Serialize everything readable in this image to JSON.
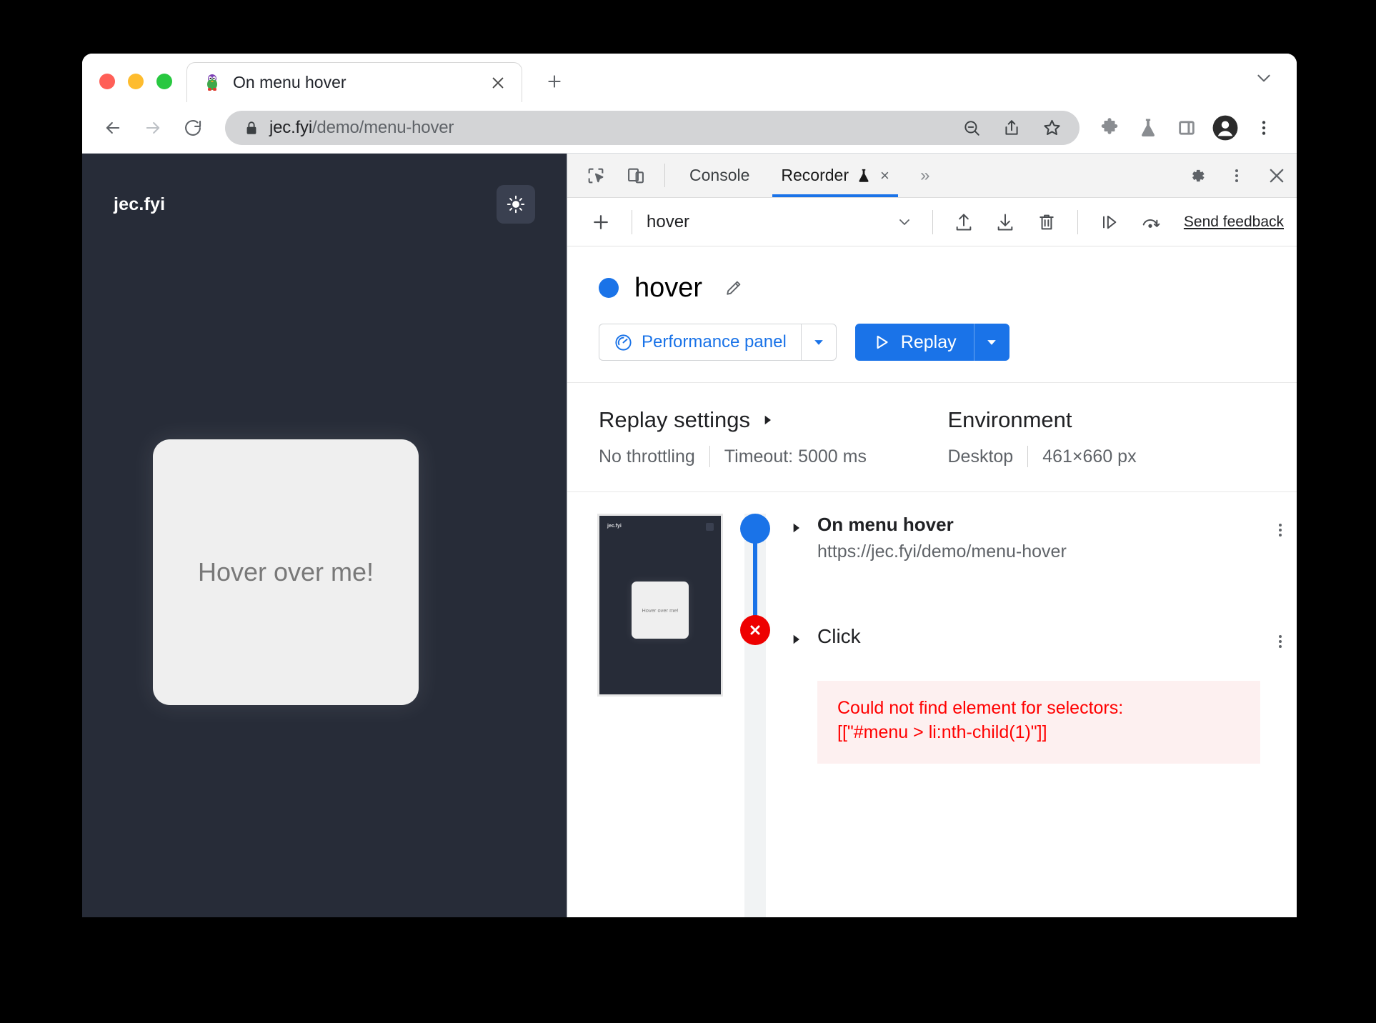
{
  "browser": {
    "tab": {
      "title": "On menu hover",
      "favicon": "penguin-favicon",
      "close": "×"
    },
    "newtab_label": "+",
    "omnibox": {
      "host": "jec.fyi",
      "path": "/demo/menu-hover",
      "lock_icon": "lock-icon",
      "zoom_out_icon": "zoom-out-icon",
      "share_icon": "share-icon",
      "bookmark_icon": "star-icon"
    },
    "toolbar_icons": [
      "extensions-puzzle-icon",
      "experiments-flask-icon",
      "side-panel-icon",
      "profile-avatar-icon",
      "chrome-menu-icon"
    ],
    "nav": {
      "back": "back-arrow-icon",
      "forward": "forward-arrow-icon",
      "reload": "reload-icon"
    }
  },
  "page": {
    "logo": "jec.fyi",
    "theme_toggle_icon": "sun-icon",
    "card_label": "Hover over me!"
  },
  "devtools": {
    "tools": {
      "inspect": "inspect-element-icon",
      "device": "device-toolbar-icon"
    },
    "tabs": [
      {
        "label": "Console",
        "active": false
      },
      {
        "label": "Recorder",
        "active": true,
        "badge": "flask-icon",
        "close": "×"
      }
    ],
    "overflow": "»",
    "right_icons": [
      "settings-gear-icon",
      "more-options-icon",
      "close-devtools-icon"
    ],
    "recorder_toolbar": {
      "add_label": "+",
      "recording_name": "hover",
      "name_chevron": "chevron-down-icon",
      "import_icon": "import-icon",
      "export_icon": "export-icon",
      "delete_icon": "trash-icon",
      "step_icon": "step-over-icon",
      "replay_speed_icon": "replay-speed-icon",
      "feedback_label": "Send feedback"
    },
    "recording": {
      "title": "hover",
      "status_color": "#1a73e8",
      "edit_icon": "pencil-icon",
      "performance_button": "Performance panel",
      "performance_icon": "performance-icon",
      "performance_caret": "▼",
      "replay_button": "Replay",
      "replay_icon": "play-triangle-icon",
      "replay_caret": "▼"
    },
    "replay_settings": {
      "title": "Replay settings",
      "expand_icon": "▶",
      "throttling": "No throttling",
      "timeout": "Timeout: 5000 ms"
    },
    "environment": {
      "title": "Environment",
      "device": "Desktop",
      "viewport": "461×660 px"
    },
    "thumbnail": {
      "logo": "jec.fyi",
      "card_label": "Hover over me!"
    },
    "steps": [
      {
        "title": "On menu hover",
        "url": "https://jec.fyi/demo/menu-hover",
        "marker": "start-dot",
        "caret": "▶",
        "menu_icon": "more-options-icon"
      },
      {
        "title": "Click",
        "marker": "error-cross",
        "caret": "▶",
        "menu_icon": "more-options-icon",
        "error": {
          "line1": "Could not find element for selectors:",
          "line2": "[[\"#menu > li:nth-child(1)\"]]"
        }
      }
    ]
  },
  "colors": {
    "accent": "#1a73e8",
    "error": "#ff0000",
    "page_bg": "#272c38",
    "card_bg": "#efefef"
  }
}
